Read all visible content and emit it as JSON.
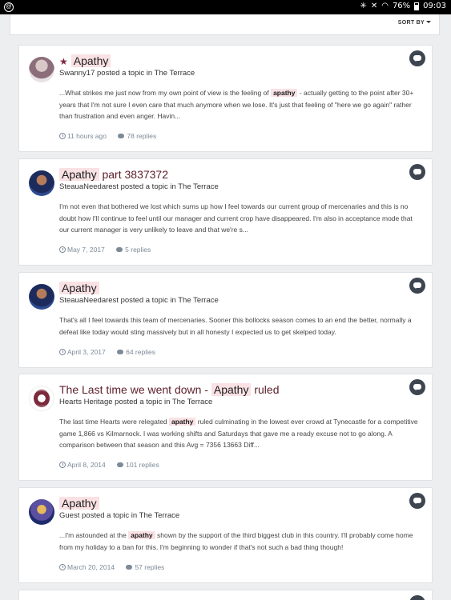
{
  "status_bar": {
    "battery": "76%",
    "time": "09:03"
  },
  "toolbar": {
    "sort_label": "SORT BY"
  },
  "results": [
    {
      "title_pre": "",
      "title_hl": "Apathy",
      "title_post": "",
      "starred": true,
      "author": "Swanny17",
      "action": " posted a topic in ",
      "forum": "The Terrace",
      "snippet_pre": "...What strikes me just now from my own point of view is the feeling of ",
      "snippet_hl": "apathy",
      "snippet_post": " - actually getting to the point after 30+ years that I'm not sure I even care that much anymore when we lose. It's just that feeling of \"here we go again\" rather than frustration and even anger. Havin...",
      "time": "11 hours ago",
      "replies": "78 replies"
    },
    {
      "title_pre": "",
      "title_hl": "Apathy",
      "title_post": " part 3837372",
      "starred": false,
      "author": "SteauaNeedarest",
      "action": " posted a topic in ",
      "forum": "The Terrace",
      "snippet_pre": "I'm not even that bothered we lost which sums up how I feel towards our current group of mercenaries and this is no doubt how I'll continue to feel until our manager and current crop have disappeared. I'm also in acceptance mode that our current manager is very unlikely to leave and that we're s...",
      "snippet_hl": "",
      "snippet_post": "",
      "time": "May 7, 2017",
      "replies": "5 replies"
    },
    {
      "title_pre": "",
      "title_hl": "Apathy",
      "title_post": "",
      "starred": false,
      "author": "SteauaNeedarest",
      "action": " posted a topic in ",
      "forum": "The Terrace",
      "snippet_pre": "That's all I feel towards this team of mercenaries. Sooner this bollocks season comes to an end the better, normally a defeat like today would sting massively but in all honesty I expected us to get skelped today.",
      "snippet_hl": "",
      "snippet_post": "",
      "time": "April 3, 2017",
      "replies": "64 replies"
    },
    {
      "title_pre": "The Last time we went down - ",
      "title_hl": "Apathy",
      "title_post": " ruled",
      "starred": false,
      "author": "Hearts Heritage",
      "action": " posted a topic in ",
      "forum": "The Terrace",
      "snippet_pre": "The last time Hearts were relegated ",
      "snippet_hl": "apathy",
      "snippet_post": " ruled culminating in the lowest ever crowd at Tynecastle for a competitive game 1,866 vs Kilmarnock. I was working shifts and Saturdays that gave me a ready excuse not to go along. A comparison between that season and this Avg = 7356 13663 Diff...",
      "time": "April 8, 2014",
      "replies": "101 replies"
    },
    {
      "title_pre": "",
      "title_hl": "Apathy",
      "title_post": "",
      "starred": false,
      "author": "Guest",
      "action": " posted a topic in ",
      "forum": "The Terrace",
      "snippet_pre": "...I'm astounded at the ",
      "snippet_hl": "apathy",
      "snippet_post": " shown by the support of the third biggest club in this country. I'll probably come home from my holiday to a ban for this. I'm beginning to wonder if that's not such a bad thing though!",
      "time": "March 20, 2014",
      "replies": "57 replies"
    }
  ]
}
